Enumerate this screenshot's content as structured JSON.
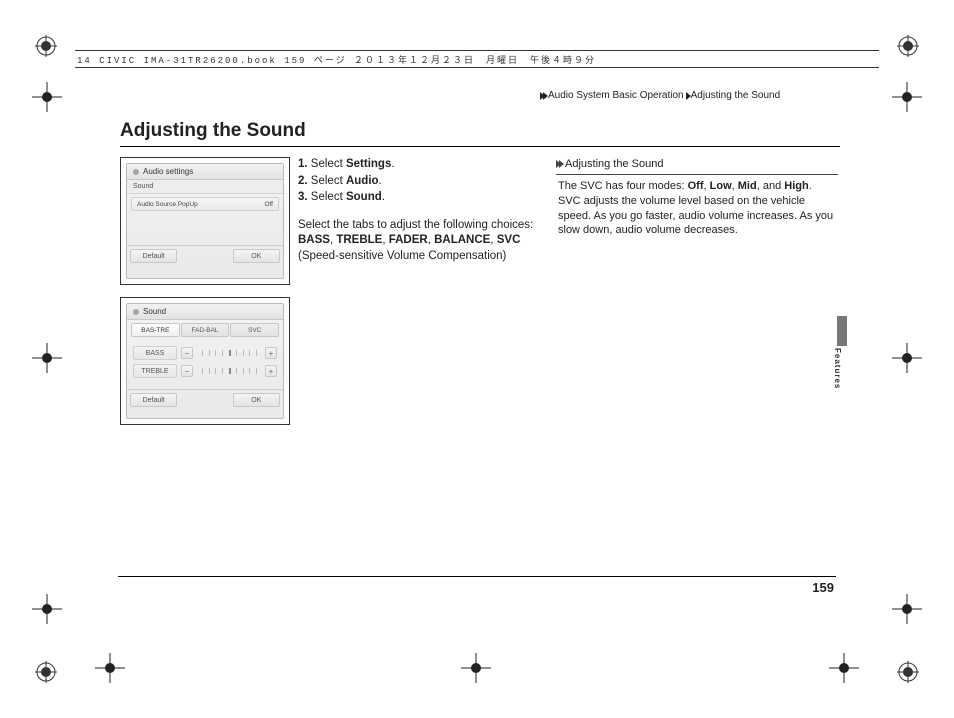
{
  "file_strip": "14 CIVIC IMA-31TR26200.book  159 ページ  ２０１３年１２月２３日　月曜日　午後４時９分",
  "breadcrumb": {
    "section": "Audio System Basic Operation",
    "page": "Adjusting the Sound"
  },
  "title": "Adjusting the Sound",
  "steps": [
    {
      "n": "1.",
      "pre": "Select ",
      "bold": "Settings",
      "post": "."
    },
    {
      "n": "2.",
      "pre": "Select ",
      "bold": "Audio",
      "post": "."
    },
    {
      "n": "3.",
      "pre": "Select ",
      "bold": "Sound",
      "post": "."
    }
  ],
  "instruction_intro": "Select the tabs to adjust the following choices:",
  "instruction_bold_list": [
    "BASS",
    "TREBLE",
    "FADER",
    "BALANCE",
    "SVC"
  ],
  "instruction_tail": "(Speed-sensitive Volume Compensation)",
  "sidebox": {
    "heading": "Adjusting the Sound",
    "p1a": "The SVC has four modes: ",
    "modes": [
      "Off",
      "Low",
      "Mid",
      "High"
    ],
    "p1b": ". SVC adjusts the volume level based on the vehicle speed. As you go faster, audio volume increases. As you slow down, audio volume decreases."
  },
  "side_label": "Features",
  "page_number": "159",
  "shot1": {
    "title": "Audio settings",
    "sub": "Sound",
    "row_label": "Audio Source PopUp",
    "row_value": "Off",
    "btn_left": "Default",
    "btn_right": "OK"
  },
  "shot2": {
    "title": "Sound",
    "tabs": [
      "BAS-TRE",
      "FAD-BAL",
      "SVC"
    ],
    "row1": "BASS",
    "row2": "TREBLE",
    "btn_left": "Default",
    "btn_right": "OK"
  }
}
